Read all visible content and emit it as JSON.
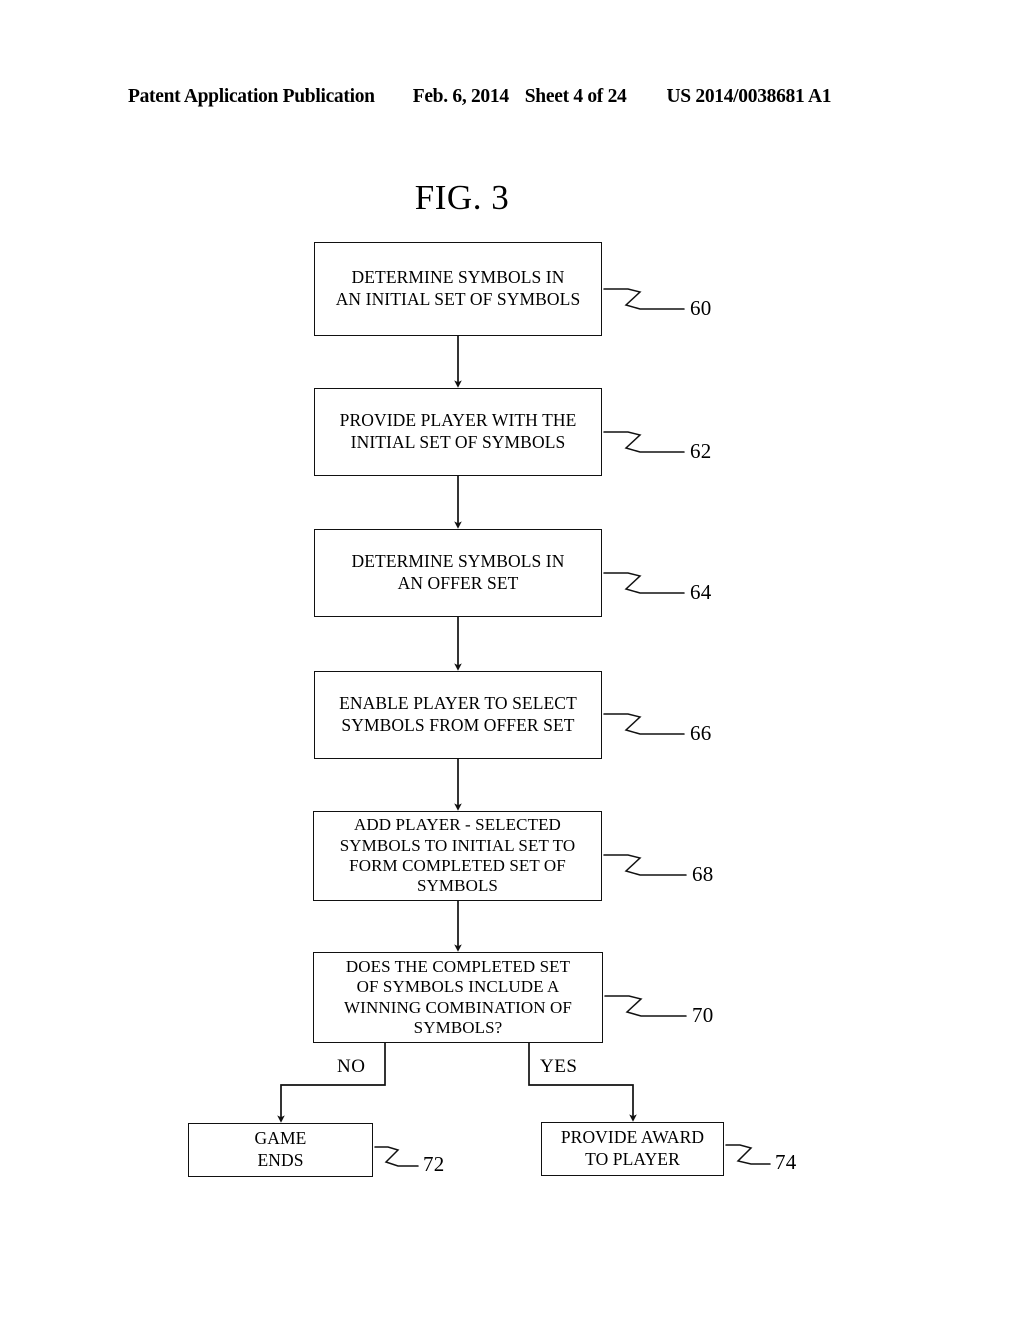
{
  "header": {
    "publication": "Patent Application Publication",
    "date": "Feb. 6, 2014",
    "sheet": "Sheet 4 of 24",
    "patent_number": "US 2014/0038681 A1"
  },
  "figure": {
    "title": "FIG. 3"
  },
  "flowchart": {
    "nodes": [
      {
        "ref": "60",
        "type": "process",
        "lines": [
          "DETERMINE SYMBOLS IN",
          "AN INITIAL SET OF SYMBOLS"
        ]
      },
      {
        "ref": "62",
        "type": "process",
        "lines": [
          "PROVIDE PLAYER WITH THE",
          "INITIAL SET OF SYMBOLS"
        ]
      },
      {
        "ref": "64",
        "type": "process",
        "lines": [
          "DETERMINE SYMBOLS IN",
          "AN OFFER SET"
        ]
      },
      {
        "ref": "66",
        "type": "process",
        "lines": [
          "ENABLE PLAYER TO SELECT",
          "SYMBOLS FROM OFFER SET"
        ]
      },
      {
        "ref": "68",
        "type": "process",
        "lines": [
          "ADD PLAYER - SELECTED",
          "SYMBOLS TO INITIAL SET TO",
          "FORM COMPLETED SET OF",
          "SYMBOLS"
        ]
      },
      {
        "ref": "70",
        "type": "decision",
        "lines": [
          "DOES THE COMPLETED SET",
          "OF SYMBOLS INCLUDE A",
          "WINNING COMBINATION OF",
          "SYMBOLS?"
        ]
      },
      {
        "ref": "72",
        "type": "terminal",
        "lines": [
          "GAME",
          "ENDS"
        ]
      },
      {
        "ref": "74",
        "type": "terminal",
        "lines": [
          "PROVIDE AWARD",
          "TO PLAYER"
        ]
      }
    ],
    "branch_labels": {
      "no": "NO",
      "yes": "YES"
    }
  }
}
